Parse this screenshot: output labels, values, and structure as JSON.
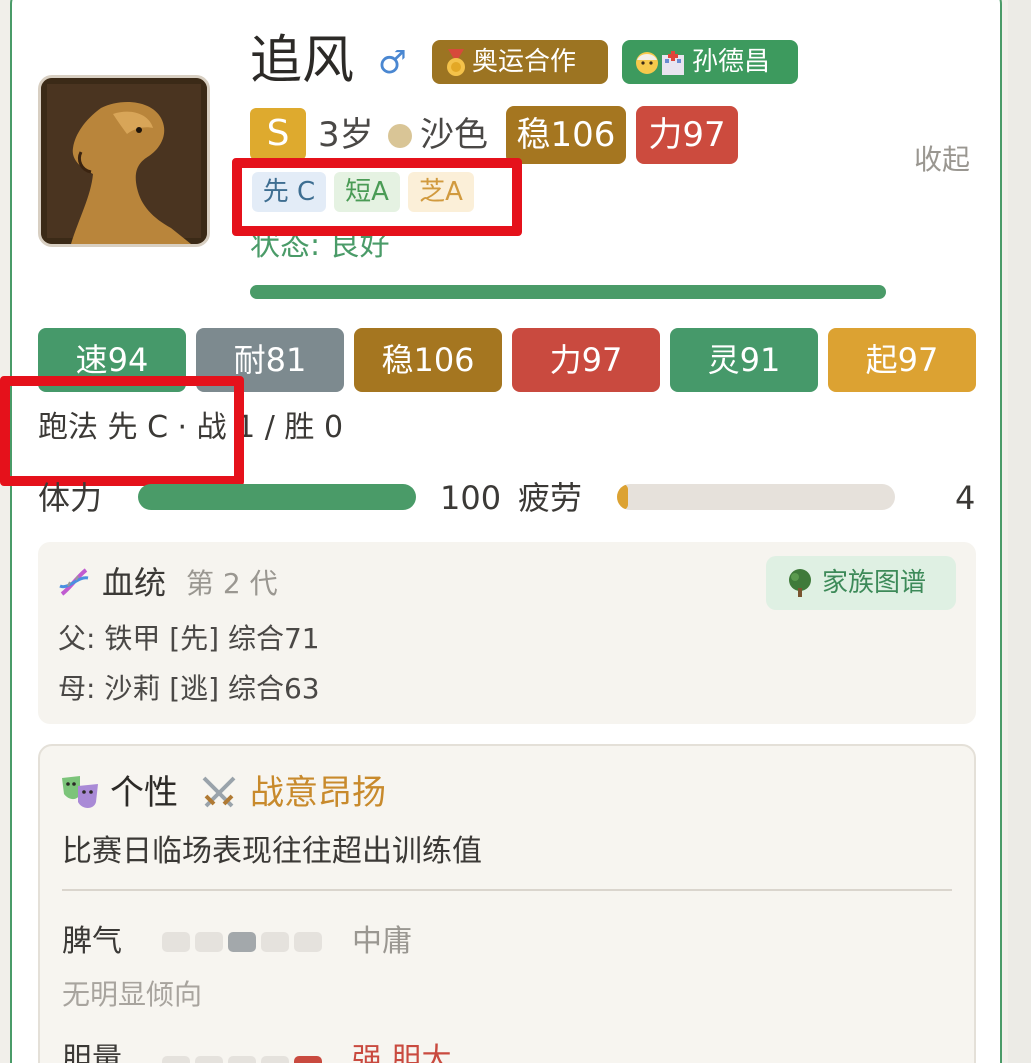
{
  "horse": {
    "name": "追风",
    "gender_symbol": "♂",
    "grade": "S",
    "age": "3岁",
    "coat": "沙色",
    "status": "状态: 良好"
  },
  "badges": {
    "olympic": "奥运合作",
    "trainer": "孙德昌"
  },
  "top_pills": {
    "stability": "稳106",
    "power": "力97"
  },
  "collapse_label": "收起",
  "mini_tags": [
    "先 C",
    "短A",
    "芝A"
  ],
  "stats": [
    "速94",
    "耐81",
    "稳106",
    "力97",
    "灵91",
    "起97"
  ],
  "run_line": "跑法 先 C · 战 1 / 胜 0",
  "stamina": {
    "label": "体力",
    "value": "100",
    "fraction": 1.0
  },
  "fatigue": {
    "label": "疲劳",
    "value": "4",
    "fraction": 0.04
  },
  "lineage": {
    "title": "血统",
    "generation": "第 2 代",
    "family_button": "家族图谱",
    "sire": "父: 铁甲 [先] 综合71",
    "dam": "母: 沙莉 [逃] 综合63"
  },
  "personality": {
    "title": "个性",
    "trait": "战意昂扬",
    "description": "比赛日临场表现往往超出训练值",
    "temper": {
      "label": "脾气",
      "value": "中庸",
      "note": "无明显倾向",
      "level": 3,
      "max": 5
    },
    "courage": {
      "label": "胆量",
      "value": "强 胆大",
      "level": 5,
      "max": 5
    }
  },
  "colors": {
    "green": "#4a9b68",
    "gold": "#a57620",
    "red": "#c94a3f",
    "gray": "#7d8a8f",
    "orange": "#dca232",
    "annotation_red": "#e5111b"
  },
  "icons": [
    "medal-icon",
    "old-man-icon",
    "hospital-icon",
    "dna-icon",
    "tree-icon",
    "theater-masks-icon",
    "crossed-swords-icon"
  ]
}
